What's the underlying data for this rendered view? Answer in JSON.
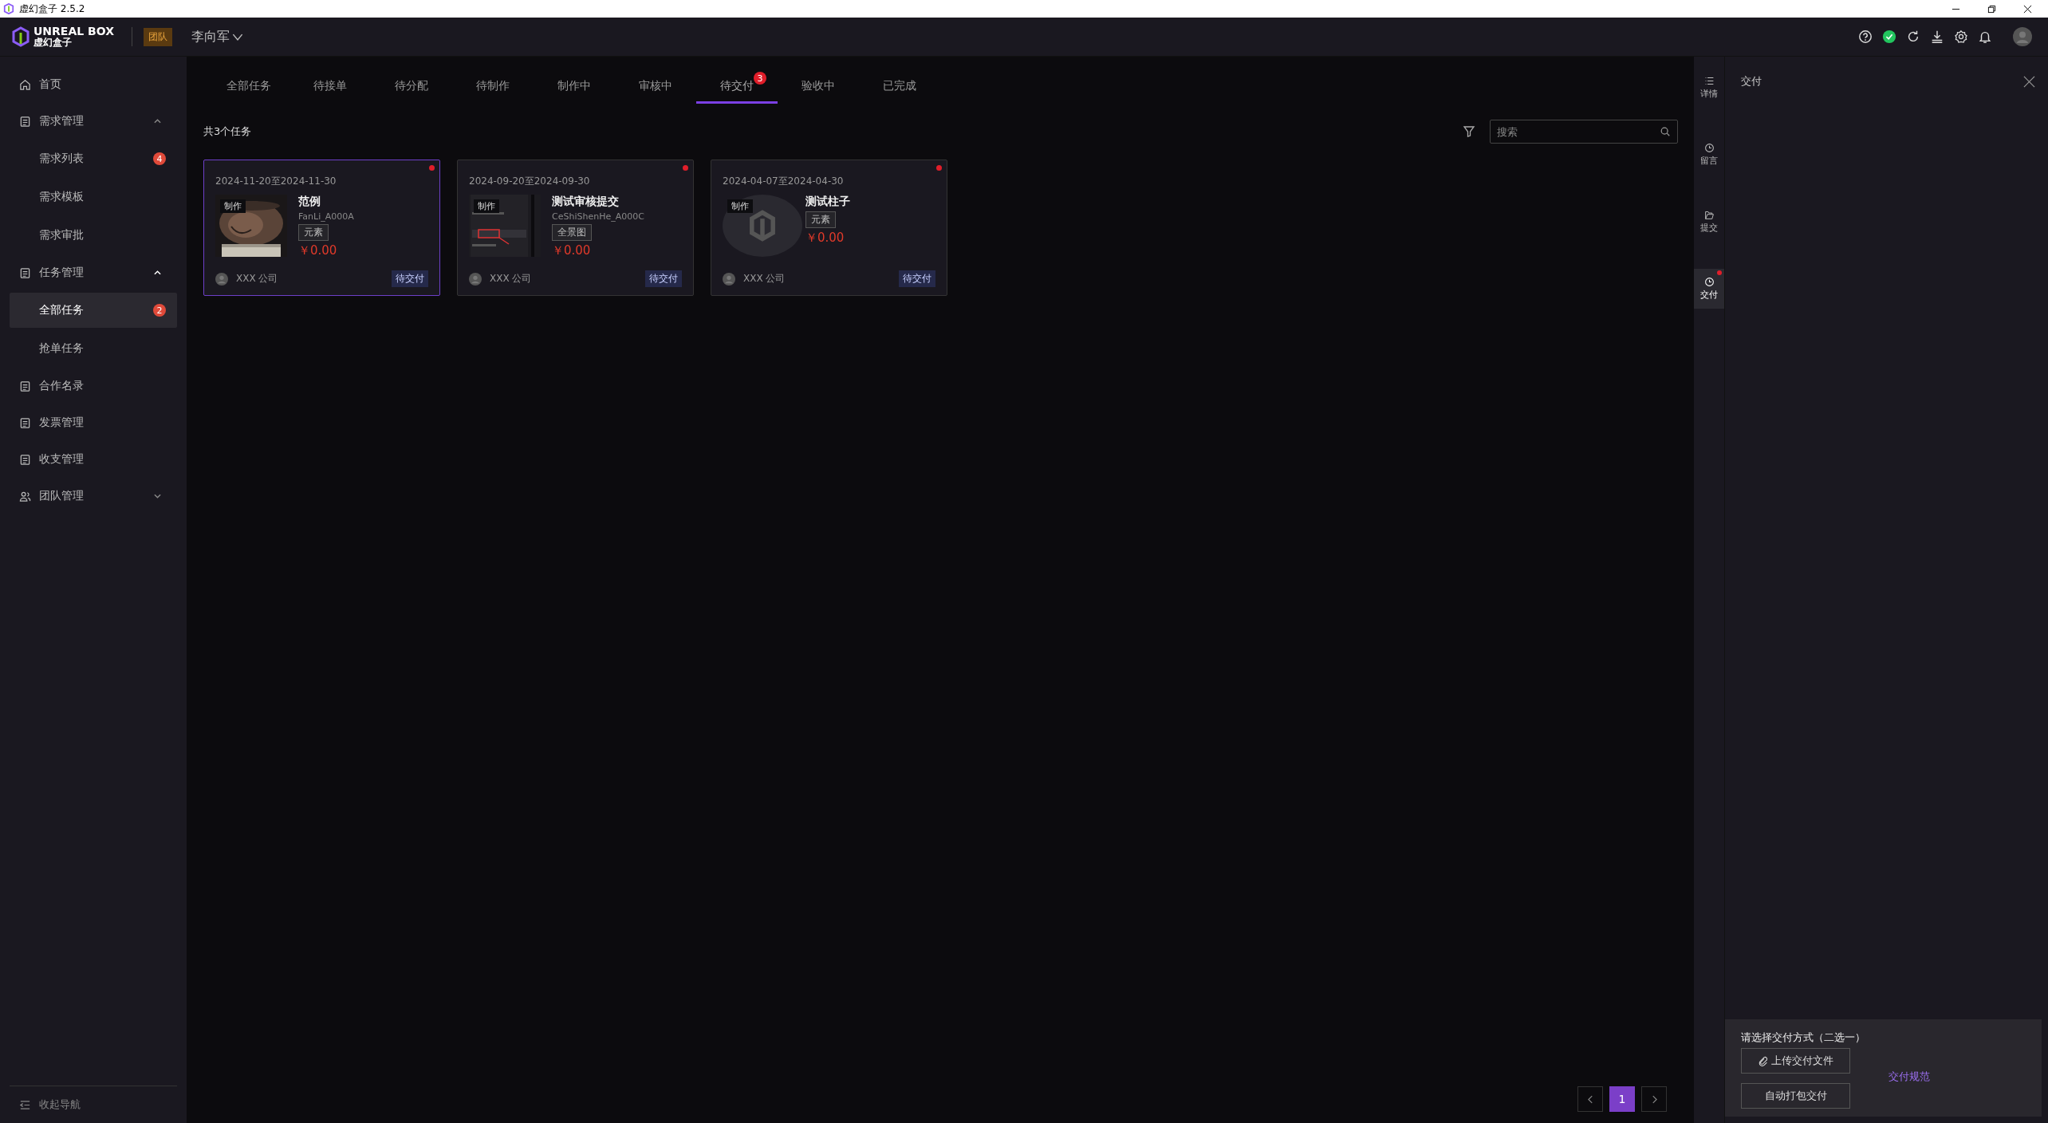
{
  "title_bar": {
    "title": "虚幻盒子 2.5.2"
  },
  "header": {
    "logo_en": "UNREAL BOX",
    "logo_cn": "虚幻盒子",
    "team_tag": "团队",
    "user": "李向军"
  },
  "sidebar": {
    "items": [
      {
        "label": "首页",
        "selected": false
      },
      {
        "label": "需求管理",
        "selected": false,
        "expanded": true,
        "children": [
          {
            "label": "需求列表",
            "selected": false,
            "badge": "4"
          },
          {
            "label": "需求模板",
            "selected": false
          },
          {
            "label": "需求审批",
            "selected": false
          }
        ]
      },
      {
        "label": "任务管理",
        "selected": false,
        "expanded": true,
        "children": [
          {
            "label": "全部任务",
            "selected": true,
            "badge": "2"
          },
          {
            "label": "抢单任务",
            "selected": false
          }
        ]
      },
      {
        "label": "合作名录",
        "selected": false
      },
      {
        "label": "发票管理",
        "selected": false
      },
      {
        "label": "收支管理",
        "selected": false
      },
      {
        "label": "团队管理",
        "selected": false,
        "expanded": false
      }
    ],
    "collapse_label": "收起导航"
  },
  "tabs": [
    {
      "label": "全部任务",
      "selected": false
    },
    {
      "label": "待接单",
      "selected": false
    },
    {
      "label": "待分配",
      "selected": false
    },
    {
      "label": "待制作",
      "selected": false
    },
    {
      "label": "制作中",
      "selected": false
    },
    {
      "label": "审核中",
      "selected": false
    },
    {
      "label": "待交付",
      "selected": true,
      "badge": "3"
    },
    {
      "label": "验收中",
      "selected": false
    },
    {
      "label": "已完成",
      "selected": false
    }
  ],
  "task_count": "共3个任务",
  "search": {
    "placeholder": "搜索"
  },
  "cards": [
    {
      "dates": "2024-11-20至2024-11-30",
      "title": "范例",
      "code": "FanLi_A000A",
      "tag": "元素",
      "price": "￥0.00",
      "stage": "制作",
      "company": "XXX 公司",
      "status": "待交付",
      "selected": true,
      "unread": true,
      "kind": "picture"
    },
    {
      "dates": "2024-09-20至2024-09-30",
      "title": "测试审核提交",
      "code": "CeShiShenHe_A000C",
      "tag": "全景图",
      "price": "￥0.00",
      "stage": "制作",
      "company": "XXX 公司",
      "status": "待交付",
      "selected": false,
      "unread": true,
      "kind": "picture"
    },
    {
      "dates": "2024-04-07至2024-04-30",
      "title": "测试柱子",
      "tag": "元素",
      "price": "￥0.00",
      "stage": "制作",
      "company": "XXX 公司",
      "status": "待交付",
      "selected": false,
      "unread": true,
      "kind": "placeholder"
    }
  ],
  "pagination": {
    "pages": [
      {
        "label": "1",
        "selected": true
      }
    ]
  },
  "right_rail": [
    {
      "label": "详情",
      "selected": false,
      "dot": false
    },
    {
      "label": "留言",
      "selected": false,
      "dot": false
    },
    {
      "label": "提交",
      "selected": false,
      "dot": false
    },
    {
      "label": "交付",
      "selected": true,
      "dot": true
    }
  ],
  "panel": {
    "title": "交付",
    "prompt": "请选择交付方式（二选一）",
    "upload_button": "上传交付文件",
    "auto_button": "自动打包交付",
    "spec_link": "交付规范"
  }
}
